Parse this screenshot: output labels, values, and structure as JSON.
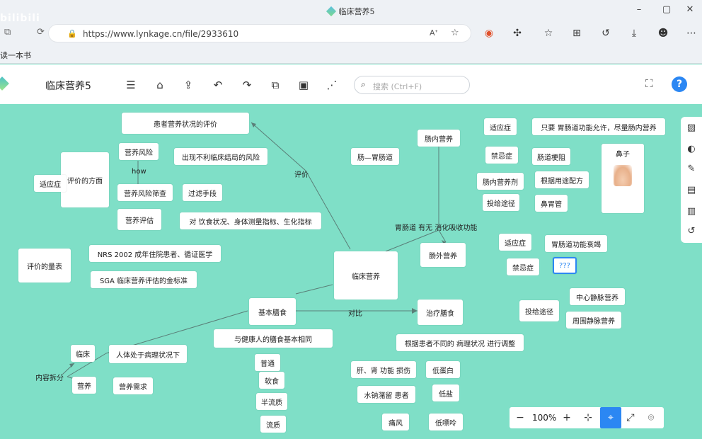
{
  "browser": {
    "window_title": "临床营养5",
    "url": "https://www.lynkage.cn/file/2933610",
    "bookmark": "读一本书",
    "watermark": "bilibili"
  },
  "app": {
    "title": "临床营养5",
    "search_placeholder": "搜索 (Ctrl+F)",
    "help_label": "?"
  },
  "zoom": {
    "value": "100%",
    "minus": "−",
    "plus": "+"
  },
  "nodes": {
    "center": "临床营养",
    "eval_status": "患者营养状况的评价",
    "eval_aspect": "评价的方面",
    "indication_left": "适应症",
    "nutri_risk": "营养风险",
    "risk_desc": "出现不利临床结局的风险",
    "how": "how",
    "risk_screen": "营养风险筛查",
    "screen_desc": "过滤手段",
    "nutri_assess": "营养评估",
    "assess_desc": "对 饮食状况、身体测量指标、生化指标",
    "eval_label": "评价",
    "scale": "评价的量表",
    "nrs": "NRS 2002 成年住院患者、循证医学",
    "sga": "SGA  临床营养评估的金标准",
    "basic_diet": "基本膳食",
    "basic_desc": "与健康人的膳食基本相同",
    "compare": "对比",
    "therapy_diet": "治疗膳食",
    "therapy_desc": "根据患者不同的 病理状况 进行调整",
    "diet_normal": "普通",
    "diet_soft": "软食",
    "diet_semi": "半流质",
    "diet_liquid": "流质",
    "content_split": "内容拆分",
    "clinical": "临床",
    "pathology": "人体处于病理状况下",
    "nutrition": "营养",
    "nutri_need": "营养需求",
    "enteral": "肠内营养",
    "gut_route": "肠—胃肠道",
    "ind_enteral": "适应症",
    "ind_enteral_desc": "只要 胃肠道功能允许，尽量肠内营养",
    "contra_enteral": "禁忌症",
    "contra_enteral_desc": "肠道梗阻",
    "formula": "肠内营养剂",
    "formula_desc": "根据用途配方",
    "route_enteral": "投给途径",
    "route_enteral_desc": "鼻胃管",
    "nose_title": "鼻子",
    "gi_function": "胃肠道 有无 消化吸收功能",
    "parenteral": "肠外营养",
    "ind_parenteral": "适应症",
    "ind_parenteral_desc": "胃肠道功能衰竭",
    "contra_parenteral": "禁忌症",
    "editing_node": "???",
    "route_parenteral": "投给途径",
    "central_vein": "中心静脉营养",
    "peripheral_vein": "周围静脉营养",
    "liver_kidney": "肝、肾 功能 损伤",
    "low_protein": "低蛋白",
    "edema": "水钠潴留 患者",
    "low_salt": "低盐",
    "gout": "痛风",
    "low_purine": "低嘌呤"
  },
  "icons": {
    "toolbar": [
      "outline-icon",
      "home-icon",
      "export-icon",
      "undo-icon",
      "redo-icon",
      "copy-icon",
      "save-icon",
      "share-icon"
    ],
    "right_panel": [
      "image-icon",
      "palette-icon",
      "brush-icon",
      "comment-icon",
      "chart-icon",
      "history-icon"
    ],
    "zoom_bar": [
      "fit-icon",
      "locate-node-icon",
      "fullscreen-icon",
      "location-icon"
    ]
  }
}
